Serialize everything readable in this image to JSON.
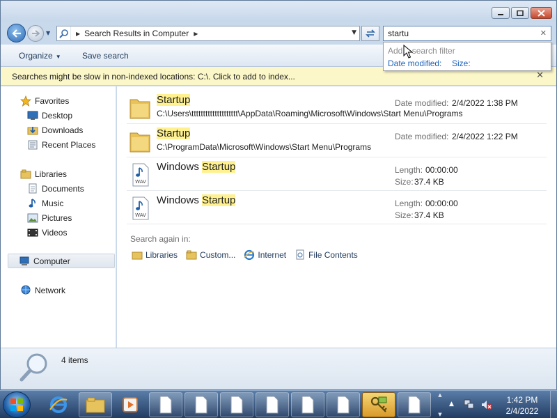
{
  "window": {
    "address_path": "Search Results in Computer",
    "search_query": "startu"
  },
  "toolbar": {
    "organize_label": "Organize",
    "save_search_label": "Save search"
  },
  "infobar": {
    "message": "Searches might be slow in non-indexed locations: C:\\. Click to add to index..."
  },
  "search_filter": {
    "hint": "Add a search filter",
    "options": [
      "Date modified:",
      "Size:"
    ]
  },
  "nav": {
    "favorites": {
      "label": "Favorites",
      "items": [
        {
          "label": "Desktop",
          "icon": "desktop-icon"
        },
        {
          "label": "Downloads",
          "icon": "downloads-icon"
        },
        {
          "label": "Recent Places",
          "icon": "recent-places-icon"
        }
      ]
    },
    "libraries": {
      "label": "Libraries",
      "items": [
        {
          "label": "Documents",
          "icon": "documents-icon"
        },
        {
          "label": "Music",
          "icon": "music-icon"
        },
        {
          "label": "Pictures",
          "icon": "pictures-icon"
        },
        {
          "label": "Videos",
          "icon": "videos-icon"
        }
      ]
    },
    "computer_label": "Computer",
    "network_label": "Network"
  },
  "results": [
    {
      "type": "folder",
      "name_before": "",
      "name_match": "Startup",
      "path": "C:\\Users\\tttttttttttttttttttt\\AppData\\Roaming\\Microsoft\\Windows\\Start Menu\\Programs",
      "meta": [
        {
          "label": "Date modified:",
          "value": "2/4/2022 1:38 PM"
        }
      ]
    },
    {
      "type": "folder",
      "name_before": "",
      "name_match": "Startup",
      "path": "C:\\ProgramData\\Microsoft\\Windows\\Start Menu\\Programs",
      "meta": [
        {
          "label": "Date modified:",
          "value": "2/4/2022 1:22 PM"
        }
      ]
    },
    {
      "type": "wav",
      "name_before": "Windows ",
      "name_match": "Startup",
      "path": "",
      "meta": [
        {
          "label": "Length:",
          "value": "00:00:00"
        },
        {
          "label": "Size:",
          "value": "37.4 KB"
        }
      ]
    },
    {
      "type": "wav",
      "name_before": "Windows ",
      "name_match": "Startup",
      "path": "",
      "meta": [
        {
          "label": "Length:",
          "value": "00:00:00"
        },
        {
          "label": "Size:",
          "value": "37.4 KB"
        }
      ]
    }
  ],
  "wav_badge": "WAV",
  "search_again": {
    "title": "Search again in:",
    "options": [
      "Libraries",
      "Custom...",
      "Internet",
      "File Contents"
    ]
  },
  "details": {
    "count_text": "4 items"
  },
  "taskbar": {
    "time": "1:42 PM",
    "date": "2/4/2022"
  },
  "colors": {
    "highlight": "#fff190",
    "link": "#1c61b8",
    "infobar": "#fcf7c9"
  }
}
